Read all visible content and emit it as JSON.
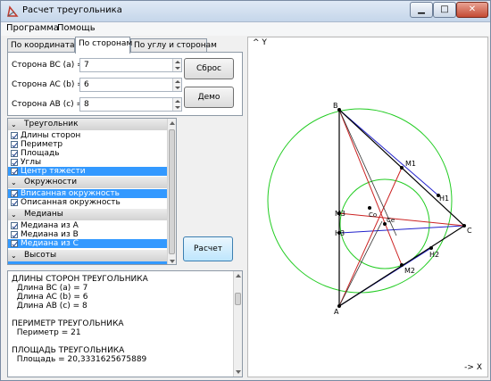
{
  "window": {
    "title": "Расчет треугольника"
  },
  "menu": [
    "Программа",
    "Помощь"
  ],
  "tabs": [
    "По координатам",
    "По сторонам",
    "По углу и сторонам"
  ],
  "sides": [
    {
      "label": "Сторона BC (a) =",
      "value": "7"
    },
    {
      "label": "Сторона AC (b) =",
      "value": "6"
    },
    {
      "label": "Сторона AB (c) =",
      "value": "8"
    }
  ],
  "buttons": {
    "reset": "Сброс",
    "demo": "Демо",
    "calc": "Расчет"
  },
  "options": [
    {
      "title": "Треугольник",
      "items": [
        {
          "label": "Длины сторон",
          "checked": true,
          "selected": false
        },
        {
          "label": "Периметр",
          "checked": true,
          "selected": false
        },
        {
          "label": "Площадь",
          "checked": true,
          "selected": false
        },
        {
          "label": "Углы",
          "checked": true,
          "selected": false
        },
        {
          "label": "Центр тяжести",
          "checked": true,
          "selected": true
        }
      ]
    },
    {
      "title": "Окружности",
      "items": [
        {
          "label": "Вписанная окружность",
          "checked": true,
          "selected": true
        },
        {
          "label": "Описанная окружность",
          "checked": true,
          "selected": false
        }
      ]
    },
    {
      "title": "Медианы",
      "items": [
        {
          "label": "Медиана из A",
          "checked": true,
          "selected": false
        },
        {
          "label": "Медиана из B",
          "checked": true,
          "selected": false
        },
        {
          "label": "Медиана из C",
          "checked": true,
          "selected": true
        }
      ]
    },
    {
      "title": "Высоты",
      "items": []
    }
  ],
  "output": [
    "ДЛИНЫ СТОРОН ТРЕУГОЛЬНИКА",
    "  Длина BC (a) = 7",
    "  Длина AC (b) = 6",
    "  Длина AB (c) = 8",
    "",
    "ПЕРИМЕТР ТРЕУГОЛЬНИКА",
    "  Периметр = 21",
    "",
    "ПЛОЩАДЬ ТРЕУГОЛЬНИКА",
    "  Площадь = 20,3331625675889"
  ],
  "canvas": {
    "axis_y": "^ Y",
    "axis_x": "-> X",
    "points": [
      "A",
      "B",
      "C",
      "M1",
      "M2",
      "M3",
      "H1",
      "H2",
      "H3",
      "Co",
      "Ce"
    ]
  },
  "colors": {
    "selection": "#3399ff",
    "circles": "#22cc22",
    "medians": "#cc2222",
    "altitudes": "#2222cc",
    "triangle": "#000000"
  }
}
